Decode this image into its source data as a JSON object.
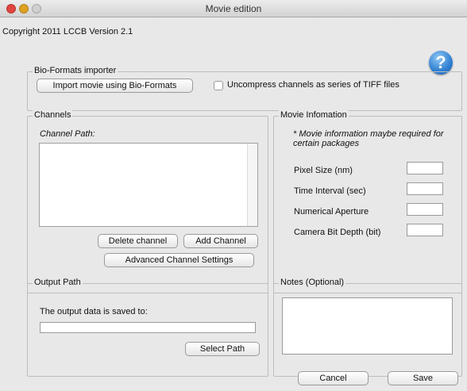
{
  "window": {
    "title": "Movie edition",
    "copyright": "Copyright 2011 LCCB   Version 2.1",
    "help_glyph": "?"
  },
  "bioformats": {
    "legend": "Bio-Formats importer",
    "import_button": "Import movie using Bio-Formats",
    "uncompress_label": "Uncompress channels as series of TIFF files",
    "uncompress_checked": false
  },
  "channels": {
    "legend": "Channels",
    "path_label": "Channel Path:",
    "delete_button": "Delete channel",
    "add_button": "Add Channel",
    "advanced_button": "Advanced Channel Settings"
  },
  "movie_info": {
    "legend": "Movie Infomation",
    "note": "* Movie information maybe required for certain packages",
    "fields": [
      {
        "label": "Pixel Size (nm)",
        "value": ""
      },
      {
        "label": "Time Interval (sec)",
        "value": ""
      },
      {
        "label": "Numerical Aperture",
        "value": ""
      },
      {
        "label": "Camera Bit Depth (bit)",
        "value": ""
      }
    ]
  },
  "output": {
    "legend": "Output Path",
    "saved_label": "The output data is saved to:",
    "path_value": "",
    "select_button": "Select Path"
  },
  "notes": {
    "legend": "Notes (Optional)",
    "value": ""
  },
  "footer": {
    "cancel_button": "Cancel",
    "save_button": "Save"
  }
}
